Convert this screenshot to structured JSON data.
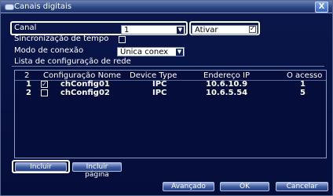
{
  "window": {
    "title": "Canais digitais",
    "close_label": "X"
  },
  "form": {
    "canal_label": "Canal",
    "canal_value": "1",
    "ativar_value": "Ativar",
    "ativar_checked": true,
    "sync_label": "Sincronização de tempo",
    "modo_label": "Modo de conexão",
    "modo_value": "Única conex",
    "lista_label": "Lista de configuração de rede"
  },
  "table": {
    "columns": [
      "2",
      "Configuração Nome",
      "Device Type",
      "Endereço IP",
      "O acesso"
    ],
    "rows": [
      {
        "num": "1",
        "checked": true,
        "name": "chConfig01",
        "type": "IPC",
        "ip": "10.6.10.9",
        "access": "1"
      },
      {
        "num": "2",
        "checked": false,
        "name": "chConfig02",
        "type": "IPC",
        "ip": "10.6.5.54",
        "access": "5"
      }
    ]
  },
  "buttons": {
    "incluir": "Incluir",
    "incluir_pagina": "Incluir página",
    "avancado": "Avançado",
    "ok": "OK",
    "cancelar": "Cancelar"
  }
}
